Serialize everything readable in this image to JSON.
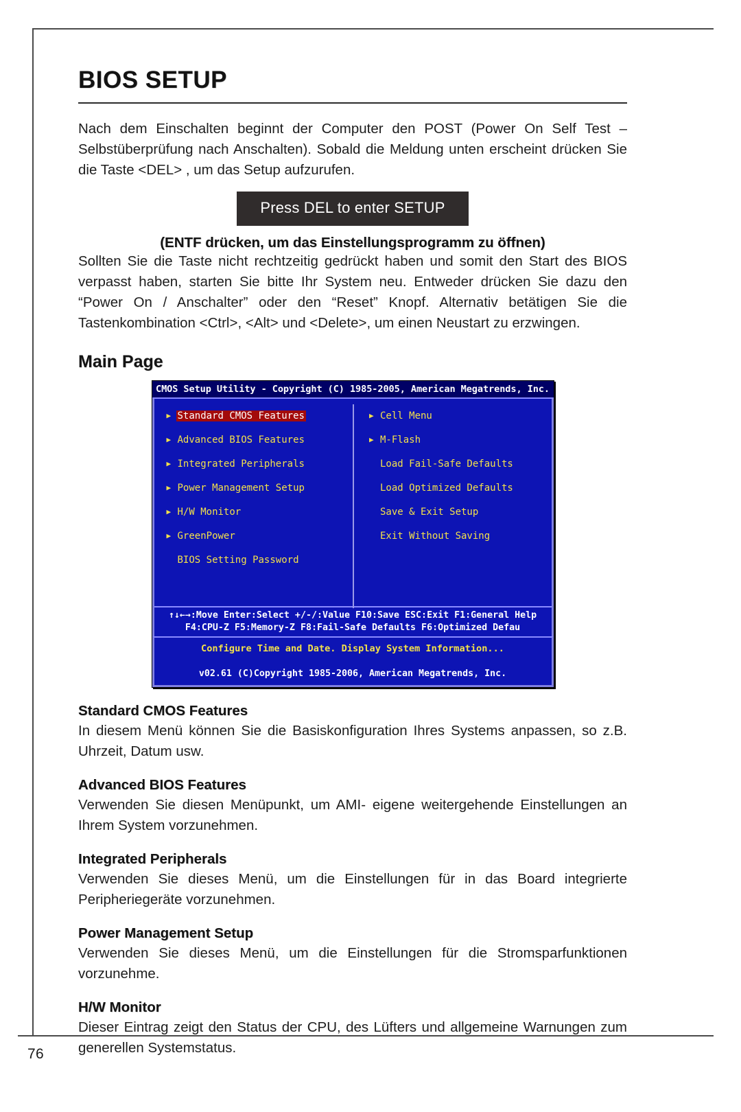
{
  "page": {
    "number": "76",
    "title": "BIOS SETUP"
  },
  "intro": {
    "paragraph1": "Nach dem Einschalten beginnt der Computer den POST (Power On Self Test – Selbstüberprüfung nach Anschalten). Sobald die Meldung unten erscheint drücken Sie die Taste <DEL> , um das Setup aufzurufen.",
    "banner": "Press DEL to enter SETUP",
    "banner_caption": "(ENTF drücken, um das Einstellungsprogramm zu öffnen)",
    "paragraph2": "Sollten Sie die Taste nicht rechtzeitig gedrückt haben und somit den Start des BIOS verpasst haben, starten Sie bitte Ihr System neu. Entweder drücken Sie dazu den “Power On / Anschalter” oder den “Reset” Knopf. Alternativ betätigen Sie die Tastenkombination <Ctrl>, <Alt> und <Delete>, um einen Neustart zu erzwingen."
  },
  "main_page": {
    "heading": "Main Page"
  },
  "bios": {
    "titlebar": "CMOS Setup Utility - Copyright (C) 1985-2005, American Megatrends, Inc.",
    "left_column": [
      {
        "label": "Standard CMOS Features",
        "arrow": true,
        "selected": true
      },
      {
        "label": "Advanced BIOS Features",
        "arrow": true,
        "selected": false
      },
      {
        "label": "Integrated Peripherals",
        "arrow": true,
        "selected": false
      },
      {
        "label": "Power Management Setup",
        "arrow": true,
        "selected": false
      },
      {
        "label": "H/W Monitor",
        "arrow": true,
        "selected": false
      },
      {
        "label": "GreenPower",
        "arrow": true,
        "selected": false
      },
      {
        "label": "BIOS Setting Password",
        "arrow": false,
        "selected": false
      }
    ],
    "right_column": [
      {
        "label": "Cell Menu",
        "arrow": true,
        "selected": false
      },
      {
        "label": "M-Flash",
        "arrow": true,
        "selected": false
      },
      {
        "label": "Load Fail-Safe Defaults",
        "arrow": false,
        "selected": false
      },
      {
        "label": "Load Optimized Defaults",
        "arrow": false,
        "selected": false
      },
      {
        "label": "Save & Exit Setup",
        "arrow": false,
        "selected": false
      },
      {
        "label": "Exit Without Saving",
        "arrow": false,
        "selected": false
      }
    ],
    "keyline1": "↑↓←→:Move   Enter:Select   +/-/:Value   F10:Save   ESC:Exit   F1:General Help",
    "keyline2": "F4:CPU-Z      F5:Memory-Z      F8:Fail-Safe Defaults      F6:Optimized Defau",
    "hint": "Configure Time and Date.  Display System Information...",
    "version": "v02.61 (C)Copyright 1985-2006, American Megatrends, Inc."
  },
  "sections": [
    {
      "heading": "Standard CMOS Features",
      "body": "In diesem Menü können Sie die Basiskonfiguration Ihres Systems anpassen, so z.B. Uhrzeit, Datum usw."
    },
    {
      "heading": "Advanced BIOS Features",
      "body": "Verwenden Sie diesen Menüpunkt, um AMI- eigene weitergehende Einstellungen an Ihrem System vorzunehmen."
    },
    {
      "heading": "Integrated Peripherals",
      "body": "Verwenden Sie dieses Menü, um die Einstellungen für in das Board integrierte Peripheriegeräte vorzunehmen."
    },
    {
      "heading": "Power Management Setup",
      "body": "Verwenden Sie dieses Menü, um die Einstellungen für die Stromsparfunktionen vorzunehme."
    },
    {
      "heading": "H/W Monitor",
      "body": "Dieser Eintrag zeigt den Status der CPU, des Lüfters und allgemeine Warnungen zum generellen Systemstatus."
    }
  ]
}
